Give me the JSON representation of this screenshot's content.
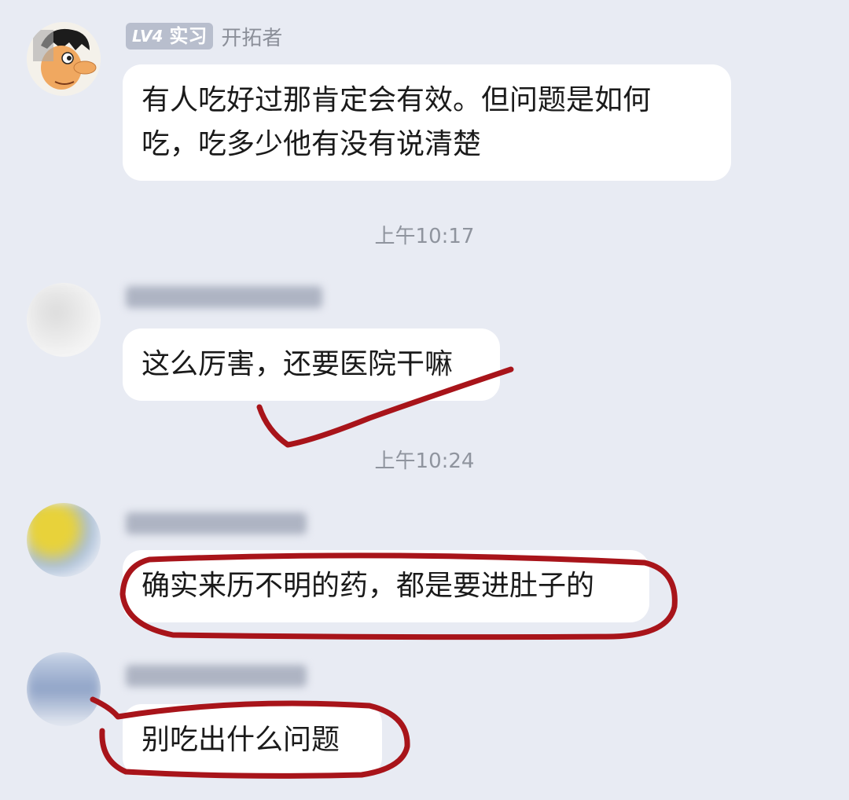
{
  "messages": [
    {
      "badge_level": "LV4",
      "badge_title": "实习",
      "role": "开拓者",
      "lines": [
        "有人吃好过那肯定会有效。但问题是如何",
        "吃，吃多少他有没有说清楚"
      ]
    },
    {
      "text": "这么厉害，还要医院干嘛"
    },
    {
      "text": "确实来历不明的药，都是要进肚子的"
    },
    {
      "text": "别吃出什么问题"
    }
  ],
  "timestamps": [
    "上午10:17",
    "上午10:24"
  ],
  "annotation_color": "#a8141a",
  "chat_bg": "#e8ebf3"
}
